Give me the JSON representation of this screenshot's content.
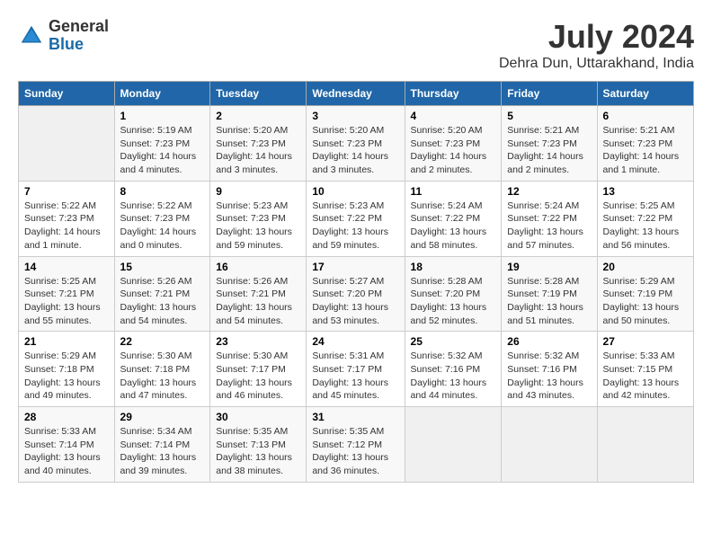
{
  "logo": {
    "general": "General",
    "blue": "Blue"
  },
  "title": {
    "month_year": "July 2024",
    "location": "Dehra Dun, Uttarakhand, India"
  },
  "days_of_week": [
    "Sunday",
    "Monday",
    "Tuesday",
    "Wednesday",
    "Thursday",
    "Friday",
    "Saturday"
  ],
  "weeks": [
    [
      {
        "day": "",
        "info": ""
      },
      {
        "day": "1",
        "info": "Sunrise: 5:19 AM\nSunset: 7:23 PM\nDaylight: 14 hours\nand 4 minutes."
      },
      {
        "day": "2",
        "info": "Sunrise: 5:20 AM\nSunset: 7:23 PM\nDaylight: 14 hours\nand 3 minutes."
      },
      {
        "day": "3",
        "info": "Sunrise: 5:20 AM\nSunset: 7:23 PM\nDaylight: 14 hours\nand 3 minutes."
      },
      {
        "day": "4",
        "info": "Sunrise: 5:20 AM\nSunset: 7:23 PM\nDaylight: 14 hours\nand 2 minutes."
      },
      {
        "day": "5",
        "info": "Sunrise: 5:21 AM\nSunset: 7:23 PM\nDaylight: 14 hours\nand 2 minutes."
      },
      {
        "day": "6",
        "info": "Sunrise: 5:21 AM\nSunset: 7:23 PM\nDaylight: 14 hours\nand 1 minute."
      }
    ],
    [
      {
        "day": "7",
        "info": "Sunrise: 5:22 AM\nSunset: 7:23 PM\nDaylight: 14 hours\nand 1 minute."
      },
      {
        "day": "8",
        "info": "Sunrise: 5:22 AM\nSunset: 7:23 PM\nDaylight: 14 hours\nand 0 minutes."
      },
      {
        "day": "9",
        "info": "Sunrise: 5:23 AM\nSunset: 7:23 PM\nDaylight: 13 hours\nand 59 minutes."
      },
      {
        "day": "10",
        "info": "Sunrise: 5:23 AM\nSunset: 7:22 PM\nDaylight: 13 hours\nand 59 minutes."
      },
      {
        "day": "11",
        "info": "Sunrise: 5:24 AM\nSunset: 7:22 PM\nDaylight: 13 hours\nand 58 minutes."
      },
      {
        "day": "12",
        "info": "Sunrise: 5:24 AM\nSunset: 7:22 PM\nDaylight: 13 hours\nand 57 minutes."
      },
      {
        "day": "13",
        "info": "Sunrise: 5:25 AM\nSunset: 7:22 PM\nDaylight: 13 hours\nand 56 minutes."
      }
    ],
    [
      {
        "day": "14",
        "info": "Sunrise: 5:25 AM\nSunset: 7:21 PM\nDaylight: 13 hours\nand 55 minutes."
      },
      {
        "day": "15",
        "info": "Sunrise: 5:26 AM\nSunset: 7:21 PM\nDaylight: 13 hours\nand 54 minutes."
      },
      {
        "day": "16",
        "info": "Sunrise: 5:26 AM\nSunset: 7:21 PM\nDaylight: 13 hours\nand 54 minutes."
      },
      {
        "day": "17",
        "info": "Sunrise: 5:27 AM\nSunset: 7:20 PM\nDaylight: 13 hours\nand 53 minutes."
      },
      {
        "day": "18",
        "info": "Sunrise: 5:28 AM\nSunset: 7:20 PM\nDaylight: 13 hours\nand 52 minutes."
      },
      {
        "day": "19",
        "info": "Sunrise: 5:28 AM\nSunset: 7:19 PM\nDaylight: 13 hours\nand 51 minutes."
      },
      {
        "day": "20",
        "info": "Sunrise: 5:29 AM\nSunset: 7:19 PM\nDaylight: 13 hours\nand 50 minutes."
      }
    ],
    [
      {
        "day": "21",
        "info": "Sunrise: 5:29 AM\nSunset: 7:18 PM\nDaylight: 13 hours\nand 49 minutes."
      },
      {
        "day": "22",
        "info": "Sunrise: 5:30 AM\nSunset: 7:18 PM\nDaylight: 13 hours\nand 47 minutes."
      },
      {
        "day": "23",
        "info": "Sunrise: 5:30 AM\nSunset: 7:17 PM\nDaylight: 13 hours\nand 46 minutes."
      },
      {
        "day": "24",
        "info": "Sunrise: 5:31 AM\nSunset: 7:17 PM\nDaylight: 13 hours\nand 45 minutes."
      },
      {
        "day": "25",
        "info": "Sunrise: 5:32 AM\nSunset: 7:16 PM\nDaylight: 13 hours\nand 44 minutes."
      },
      {
        "day": "26",
        "info": "Sunrise: 5:32 AM\nSunset: 7:16 PM\nDaylight: 13 hours\nand 43 minutes."
      },
      {
        "day": "27",
        "info": "Sunrise: 5:33 AM\nSunset: 7:15 PM\nDaylight: 13 hours\nand 42 minutes."
      }
    ],
    [
      {
        "day": "28",
        "info": "Sunrise: 5:33 AM\nSunset: 7:14 PM\nDaylight: 13 hours\nand 40 minutes."
      },
      {
        "day": "29",
        "info": "Sunrise: 5:34 AM\nSunset: 7:14 PM\nDaylight: 13 hours\nand 39 minutes."
      },
      {
        "day": "30",
        "info": "Sunrise: 5:35 AM\nSunset: 7:13 PM\nDaylight: 13 hours\nand 38 minutes."
      },
      {
        "day": "31",
        "info": "Sunrise: 5:35 AM\nSunset: 7:12 PM\nDaylight: 13 hours\nand 36 minutes."
      },
      {
        "day": "",
        "info": ""
      },
      {
        "day": "",
        "info": ""
      },
      {
        "day": "",
        "info": ""
      }
    ]
  ]
}
